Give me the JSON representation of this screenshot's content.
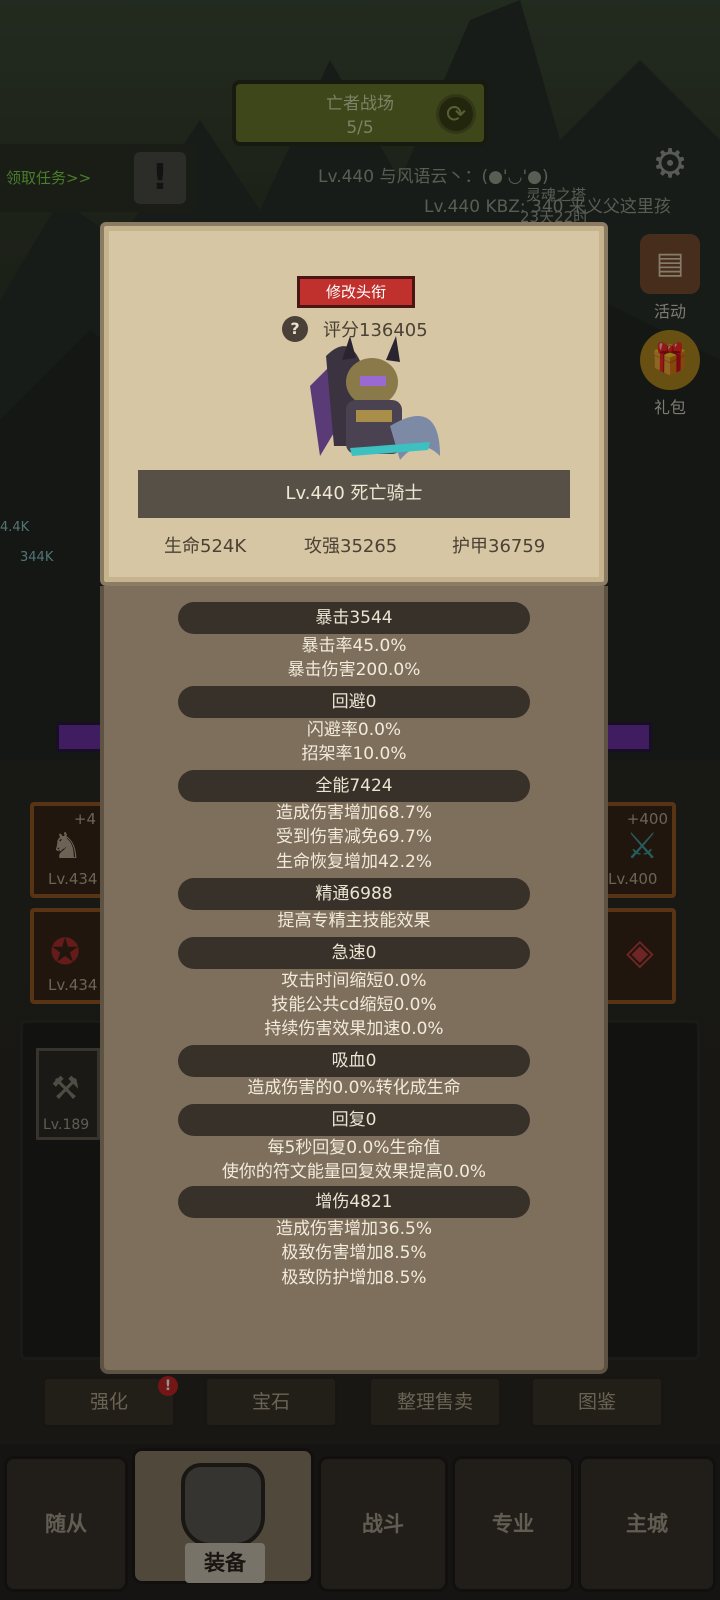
{
  "background": {
    "battle": {
      "title": "亡者战场",
      "progress": "5/5"
    },
    "task_link": "领取任务>>",
    "chat": [
      "Lv.440 与风语云丶：(●'◡'●)",
      "Lv.440 KBZ: 340 来义父这里孩",
      "灵魂之塔",
      "23天22时"
    ],
    "side_menu": [
      {
        "icon": "gear-icon",
        "label": ""
      },
      {
        "icon": "activity-icon",
        "label": "活动"
      },
      {
        "icon": "gift-icon",
        "label": "礼包"
      }
    ],
    "equip_slots": [
      {
        "plus": "+4",
        "level": "Lv.434"
      },
      {
        "plus": "",
        "level": "Lv.434"
      },
      {
        "plus": "+400",
        "level": "Lv.400"
      },
      {
        "plus": "",
        "level": ""
      }
    ],
    "item_level": "Lv.189",
    "hp_tags": [
      "4.4K",
      "344K"
    ],
    "action_buttons": [
      "强化",
      "宝石",
      "整理售卖",
      "图鉴"
    ],
    "notification_badge": "!",
    "nav_tabs": [
      "随从",
      "装备",
      "战斗",
      "专业",
      "主城"
    ]
  },
  "profile": {
    "title_button": "修改头衔",
    "score": "评分136405",
    "hero_name": "Lv.440 死亡骑士",
    "base_stats": [
      "生命524K",
      "攻强35265",
      "护甲36759"
    ]
  },
  "stats": [
    {
      "header": "暴击3544",
      "lines": [
        "暴击率45.0%",
        "暴击伤害200.0%"
      ]
    },
    {
      "header": "回避0",
      "lines": [
        "闪避率0.0%",
        "招架率10.0%"
      ]
    },
    {
      "header": "全能7424",
      "lines": [
        "造成伤害增加68.7%",
        "受到伤害减免69.7%",
        "生命恢复增加42.2%"
      ]
    },
    {
      "header": "精通6988",
      "lines": [
        "提高专精主技能效果"
      ]
    },
    {
      "header": "急速0",
      "lines": [
        "攻击时间缩短0.0%",
        "技能公共cd缩短0.0%",
        "持续伤害效果加速0.0%"
      ]
    },
    {
      "header": "吸血0",
      "lines": [
        "造成伤害的0.0%转化成生命"
      ]
    },
    {
      "header": "回复0",
      "lines": [
        "每5秒回复0.0%生命值",
        "使你的符文能量回复效果提高0.0%"
      ]
    },
    {
      "header": "增伤4821",
      "lines": [
        "造成伤害增加36.5%",
        "极致伤害增加8.5%",
        "极致防护增加8.5%"
      ]
    }
  ]
}
